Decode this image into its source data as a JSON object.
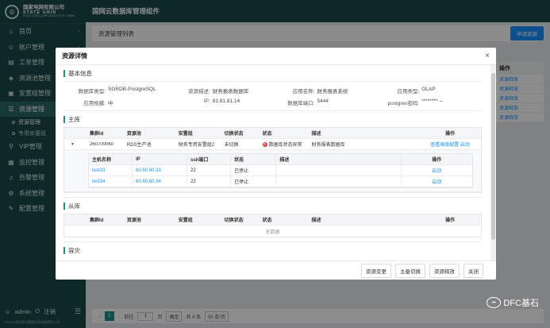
{
  "logo": {
    "cn": "国家电网有限公司",
    "en": "STATE GRID",
    "sub": "STATE GRID CORPORATION OF CHINA"
  },
  "app_title": "国网云数据库管理组件",
  "sidebar": {
    "items": [
      {
        "label": "首页",
        "icon": "home-icon",
        "chevron": "›"
      },
      {
        "label": "账户管理",
        "icon": "user-icon",
        "chevron": "›"
      },
      {
        "label": "工单管理",
        "icon": "ticket-icon",
        "chevron": "›"
      },
      {
        "label": "资源池管理",
        "icon": "pool-icon",
        "chevron": "›"
      },
      {
        "label": "安置组管理",
        "icon": "group-icon",
        "chevron": "›"
      },
      {
        "label": "资源管理",
        "icon": "resource-icon",
        "chevron": "⌄"
      }
    ],
    "subitems": [
      {
        "label": "资源管理"
      },
      {
        "label": "专用安置组"
      }
    ],
    "items2": [
      {
        "label": "VIP管理",
        "icon": "vip-icon",
        "chevron": "›"
      },
      {
        "label": "监控管理",
        "icon": "monitor-icon",
        "chevron": "›"
      },
      {
        "label": "告警管理",
        "icon": "bell-icon",
        "chevron": "›"
      },
      {
        "label": "系统管理",
        "icon": "gear-icon",
        "chevron": "›"
      },
      {
        "label": "配置管理",
        "icon": "config-icon",
        "chevron": "›"
      }
    ],
    "user": "admin",
    "logout": "注销",
    "copyright": "©2016 南京基石数据技术有限责任公司"
  },
  "content": {
    "title": "资源管理列表",
    "apply_button": "申请资源",
    "ops_header": "操作",
    "ops": [
      "资源释放",
      "资源释放",
      "资源释放",
      "资源释放",
      "资源释放"
    ],
    "pager": {
      "page": "1",
      "goto_label": "前往",
      "goto_value": "1",
      "page_unit": "页",
      "confirm": "确定",
      "total": "共 4 条",
      "size": "50 条/页"
    }
  },
  "modal": {
    "title": "资源详情",
    "basic_title": "基本信息",
    "basic": [
      {
        "label": "数据库类型:",
        "value": "SGRDB-PostgreSQL"
      },
      {
        "label": "资源描述:",
        "value": "财务报表数据库"
      },
      {
        "label": "应用名称:",
        "value": "财务报表系统"
      },
      {
        "label": "应用类型:",
        "value": "OLAP"
      },
      {
        "label": "应用规模:",
        "value": "中"
      },
      {
        "label": "IP:",
        "value": "81.81.81.14"
      },
      {
        "label": "数据库端口:",
        "value": "5444"
      },
      {
        "label": "postgres密码:",
        "value": "******** ⌣"
      }
    ],
    "master_title": "主库",
    "headers": [
      "集群Id",
      "资源池",
      "安置组",
      "切换状态",
      "状态",
      "描述",
      "操作"
    ],
    "master_row": {
      "cluster_id": "260700060",
      "pool": "RDS生产池",
      "group": "财务专用安置组2",
      "switch": "未切换",
      "status": "数据库状态异常",
      "desc": "财务报表数据库",
      "op1": "查看高级配置",
      "op2": "启动"
    },
    "host_headers": [
      "主机名称",
      "IP",
      "ssh端口",
      "状态",
      "描述",
      "操作"
    ],
    "hosts": [
      {
        "name": "test33",
        "ip": "60.60.60.33",
        "port": "22",
        "status": "已停止",
        "desc": "",
        "op": "启动"
      },
      {
        "name": "test34",
        "ip": "60.60.60.34",
        "port": "22",
        "status": "已停止",
        "desc": "",
        "op": "启动"
      }
    ],
    "slave_title": "从库",
    "empty_text": "无数据",
    "next_title": "容灾",
    "buttons": [
      "资源变更",
      "主备切换",
      "资源释放",
      "关闭"
    ],
    "close_icon": "×"
  },
  "watermark": "DFC基石"
}
